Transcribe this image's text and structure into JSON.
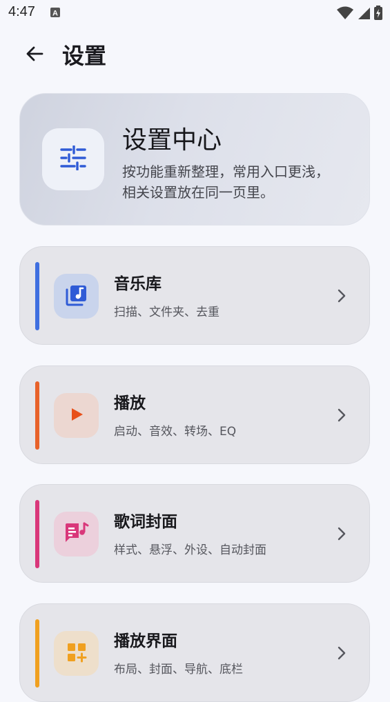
{
  "status_bar": {
    "time": "4:47",
    "icons": [
      "font-notification-icon",
      "wifi-icon",
      "cellular-signal-icon",
      "battery-charging-icon"
    ]
  },
  "app_bar": {
    "title": "设置",
    "back_icon": "arrow-left-icon"
  },
  "hero": {
    "title": "设置中心",
    "description": "按功能重新整理，常用入口更浅，相关设置放在同一页里。",
    "icon": "sliders-icon",
    "icon_color": "#2f5bd6"
  },
  "categories": [
    {
      "title": "音乐库",
      "subtitle": "扫描、文件夹、去重",
      "icon": "music-library-icon",
      "accent": "#3f6fe0",
      "icon_bg": "#c9d4ec"
    },
    {
      "title": "播放",
      "subtitle": "启动、音效、转场、EQ",
      "icon": "play-icon",
      "accent": "#e8622a",
      "icon_bg": "#ecd7d1"
    },
    {
      "title": "歌词封面",
      "subtitle": "样式、悬浮、外设、自动封面",
      "icon": "lyrics-icon",
      "accent": "#d9377a",
      "icon_bg": "#ecd0dc"
    },
    {
      "title": "播放界面",
      "subtitle": "布局、封面、导航、底栏",
      "icon": "layout-add-icon",
      "accent": "#f0a020",
      "icon_bg": "#eedfcb"
    }
  ]
}
